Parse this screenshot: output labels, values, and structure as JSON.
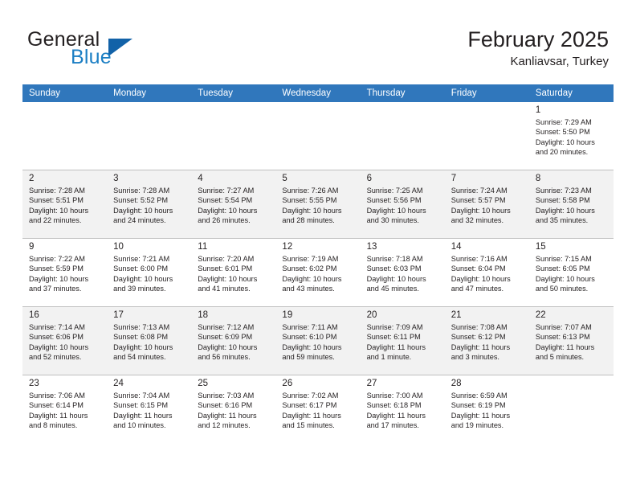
{
  "brand": {
    "word_general": "General",
    "word_blue": "Blue",
    "triangle_color": "#1262a8",
    "blue_color": "#1c7fc4"
  },
  "header": {
    "month_title": "February 2025",
    "location": "Kanliavsar, Turkey"
  },
  "theme": {
    "header_row_bg": "#3077bc",
    "header_row_text": "#ffffff",
    "shaded_row_bg": "#f2f2f2",
    "grid_line": "#bfbfbf",
    "text": "#231f20"
  },
  "weekday_headers": [
    "Sunday",
    "Monday",
    "Tuesday",
    "Wednesday",
    "Thursday",
    "Friday",
    "Saturday"
  ],
  "weeks": [
    {
      "shaded": false,
      "days": [
        {
          "empty": true
        },
        {
          "empty": true
        },
        {
          "empty": true
        },
        {
          "empty": true
        },
        {
          "empty": true
        },
        {
          "empty": true
        },
        {
          "empty": false,
          "day": "1",
          "sunrise": "Sunrise: 7:29 AM",
          "sunset": "Sunset: 5:50 PM",
          "daylight_line1": "Daylight: 10 hours",
          "daylight_line2": "and 20 minutes."
        }
      ]
    },
    {
      "shaded": true,
      "days": [
        {
          "empty": false,
          "day": "2",
          "sunrise": "Sunrise: 7:28 AM",
          "sunset": "Sunset: 5:51 PM",
          "daylight_line1": "Daylight: 10 hours",
          "daylight_line2": "and 22 minutes."
        },
        {
          "empty": false,
          "day": "3",
          "sunrise": "Sunrise: 7:28 AM",
          "sunset": "Sunset: 5:52 PM",
          "daylight_line1": "Daylight: 10 hours",
          "daylight_line2": "and 24 minutes."
        },
        {
          "empty": false,
          "day": "4",
          "sunrise": "Sunrise: 7:27 AM",
          "sunset": "Sunset: 5:54 PM",
          "daylight_line1": "Daylight: 10 hours",
          "daylight_line2": "and 26 minutes."
        },
        {
          "empty": false,
          "day": "5",
          "sunrise": "Sunrise: 7:26 AM",
          "sunset": "Sunset: 5:55 PM",
          "daylight_line1": "Daylight: 10 hours",
          "daylight_line2": "and 28 minutes."
        },
        {
          "empty": false,
          "day": "6",
          "sunrise": "Sunrise: 7:25 AM",
          "sunset": "Sunset: 5:56 PM",
          "daylight_line1": "Daylight: 10 hours",
          "daylight_line2": "and 30 minutes."
        },
        {
          "empty": false,
          "day": "7",
          "sunrise": "Sunrise: 7:24 AM",
          "sunset": "Sunset: 5:57 PM",
          "daylight_line1": "Daylight: 10 hours",
          "daylight_line2": "and 32 minutes."
        },
        {
          "empty": false,
          "day": "8",
          "sunrise": "Sunrise: 7:23 AM",
          "sunset": "Sunset: 5:58 PM",
          "daylight_line1": "Daylight: 10 hours",
          "daylight_line2": "and 35 minutes."
        }
      ]
    },
    {
      "shaded": false,
      "days": [
        {
          "empty": false,
          "day": "9",
          "sunrise": "Sunrise: 7:22 AM",
          "sunset": "Sunset: 5:59 PM",
          "daylight_line1": "Daylight: 10 hours",
          "daylight_line2": "and 37 minutes."
        },
        {
          "empty": false,
          "day": "10",
          "sunrise": "Sunrise: 7:21 AM",
          "sunset": "Sunset: 6:00 PM",
          "daylight_line1": "Daylight: 10 hours",
          "daylight_line2": "and 39 minutes."
        },
        {
          "empty": false,
          "day": "11",
          "sunrise": "Sunrise: 7:20 AM",
          "sunset": "Sunset: 6:01 PM",
          "daylight_line1": "Daylight: 10 hours",
          "daylight_line2": "and 41 minutes."
        },
        {
          "empty": false,
          "day": "12",
          "sunrise": "Sunrise: 7:19 AM",
          "sunset": "Sunset: 6:02 PM",
          "daylight_line1": "Daylight: 10 hours",
          "daylight_line2": "and 43 minutes."
        },
        {
          "empty": false,
          "day": "13",
          "sunrise": "Sunrise: 7:18 AM",
          "sunset": "Sunset: 6:03 PM",
          "daylight_line1": "Daylight: 10 hours",
          "daylight_line2": "and 45 minutes."
        },
        {
          "empty": false,
          "day": "14",
          "sunrise": "Sunrise: 7:16 AM",
          "sunset": "Sunset: 6:04 PM",
          "daylight_line1": "Daylight: 10 hours",
          "daylight_line2": "and 47 minutes."
        },
        {
          "empty": false,
          "day": "15",
          "sunrise": "Sunrise: 7:15 AM",
          "sunset": "Sunset: 6:05 PM",
          "daylight_line1": "Daylight: 10 hours",
          "daylight_line2": "and 50 minutes."
        }
      ]
    },
    {
      "shaded": true,
      "days": [
        {
          "empty": false,
          "day": "16",
          "sunrise": "Sunrise: 7:14 AM",
          "sunset": "Sunset: 6:06 PM",
          "daylight_line1": "Daylight: 10 hours",
          "daylight_line2": "and 52 minutes."
        },
        {
          "empty": false,
          "day": "17",
          "sunrise": "Sunrise: 7:13 AM",
          "sunset": "Sunset: 6:08 PM",
          "daylight_line1": "Daylight: 10 hours",
          "daylight_line2": "and 54 minutes."
        },
        {
          "empty": false,
          "day": "18",
          "sunrise": "Sunrise: 7:12 AM",
          "sunset": "Sunset: 6:09 PM",
          "daylight_line1": "Daylight: 10 hours",
          "daylight_line2": "and 56 minutes."
        },
        {
          "empty": false,
          "day": "19",
          "sunrise": "Sunrise: 7:11 AM",
          "sunset": "Sunset: 6:10 PM",
          "daylight_line1": "Daylight: 10 hours",
          "daylight_line2": "and 59 minutes."
        },
        {
          "empty": false,
          "day": "20",
          "sunrise": "Sunrise: 7:09 AM",
          "sunset": "Sunset: 6:11 PM",
          "daylight_line1": "Daylight: 11 hours",
          "daylight_line2": "and 1 minute."
        },
        {
          "empty": false,
          "day": "21",
          "sunrise": "Sunrise: 7:08 AM",
          "sunset": "Sunset: 6:12 PM",
          "daylight_line1": "Daylight: 11 hours",
          "daylight_line2": "and 3 minutes."
        },
        {
          "empty": false,
          "day": "22",
          "sunrise": "Sunrise: 7:07 AM",
          "sunset": "Sunset: 6:13 PM",
          "daylight_line1": "Daylight: 11 hours",
          "daylight_line2": "and 5 minutes."
        }
      ]
    },
    {
      "shaded": false,
      "days": [
        {
          "empty": false,
          "day": "23",
          "sunrise": "Sunrise: 7:06 AM",
          "sunset": "Sunset: 6:14 PM",
          "daylight_line1": "Daylight: 11 hours",
          "daylight_line2": "and 8 minutes."
        },
        {
          "empty": false,
          "day": "24",
          "sunrise": "Sunrise: 7:04 AM",
          "sunset": "Sunset: 6:15 PM",
          "daylight_line1": "Daylight: 11 hours",
          "daylight_line2": "and 10 minutes."
        },
        {
          "empty": false,
          "day": "25",
          "sunrise": "Sunrise: 7:03 AM",
          "sunset": "Sunset: 6:16 PM",
          "daylight_line1": "Daylight: 11 hours",
          "daylight_line2": "and 12 minutes."
        },
        {
          "empty": false,
          "day": "26",
          "sunrise": "Sunrise: 7:02 AM",
          "sunset": "Sunset: 6:17 PM",
          "daylight_line1": "Daylight: 11 hours",
          "daylight_line2": "and 15 minutes."
        },
        {
          "empty": false,
          "day": "27",
          "sunrise": "Sunrise: 7:00 AM",
          "sunset": "Sunset: 6:18 PM",
          "daylight_line1": "Daylight: 11 hours",
          "daylight_line2": "and 17 minutes."
        },
        {
          "empty": false,
          "day": "28",
          "sunrise": "Sunrise: 6:59 AM",
          "sunset": "Sunset: 6:19 PM",
          "daylight_line1": "Daylight: 11 hours",
          "daylight_line2": "and 19 minutes."
        },
        {
          "empty": true
        }
      ]
    }
  ]
}
